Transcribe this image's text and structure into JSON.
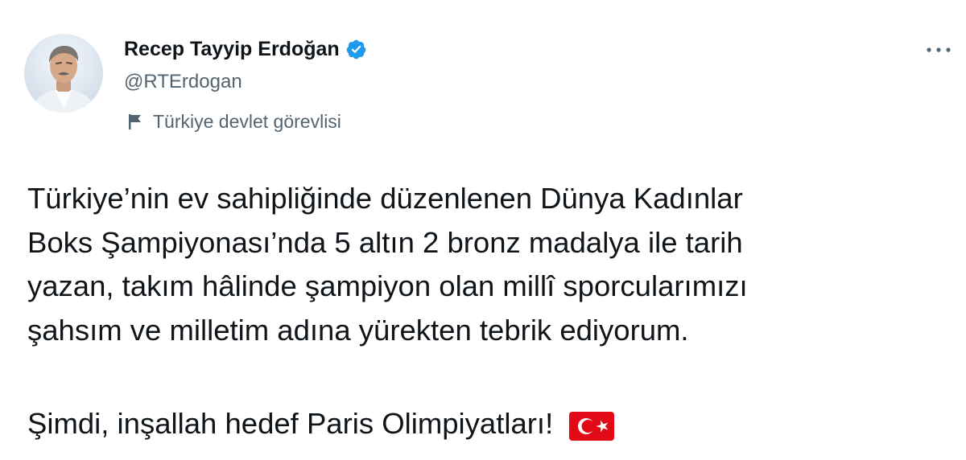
{
  "author": {
    "display_name": "Recep Tayyip Erdoğan",
    "handle": "@RTErdogan",
    "verified": true,
    "account_label": "Türkiye devlet görevlisi"
  },
  "tweet": {
    "paragraph1_lines": [
      "Türkiye’nin ev sahipliğinde düzenlenen Dünya Kadınlar",
      "Boks Şampiyonası’nda 5 altın 2 bronz madalya ile tarih",
      "yazan, takım hâlinde şampiyon olan millî sporcularımızı",
      "şahsım ve milletim adına yürekten tebrik ediyorum."
    ],
    "paragraph2": "Şimdi, inşallah hedef Paris Olimpiyatları!",
    "emoji": "turkey-flag"
  },
  "icons": {
    "verified": "verified-badge-icon",
    "label": "government-flag-icon",
    "more": "more-options-icon"
  },
  "colors": {
    "text": "#0f1419",
    "secondary": "#536471",
    "verified_blue": "#1d9bf0",
    "turkey_red": "#e30a17"
  }
}
